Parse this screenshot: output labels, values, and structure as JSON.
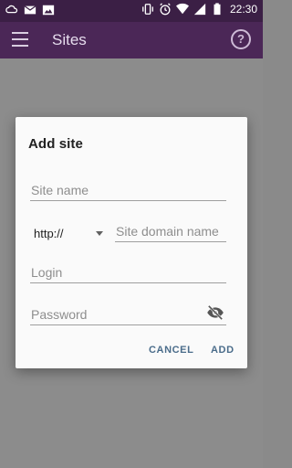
{
  "status_bar": {
    "time": "22:30",
    "left_icons": [
      "cloud-sync-icon",
      "mail-icon",
      "image-icon"
    ],
    "right_icons": [
      "vibrate-icon",
      "alarm-icon",
      "wifi-icon",
      "signal-icon",
      "battery-icon"
    ]
  },
  "app_bar": {
    "title": "Sites",
    "menu_icon": "menu-icon",
    "help_icon": "help-icon",
    "help_glyph": "?",
    "color": "#4b2757"
  },
  "dialog": {
    "title": "Add site",
    "site_name": {
      "placeholder": "Site name",
      "value": ""
    },
    "protocol": {
      "selected": "http://"
    },
    "domain": {
      "placeholder": "Site domain name",
      "value": ""
    },
    "login": {
      "placeholder": "Login",
      "value": ""
    },
    "password": {
      "placeholder": "Password",
      "value": "",
      "toggle_icon": "eye-off-icon"
    },
    "buttons": {
      "cancel": "CANCEL",
      "add": "ADD"
    },
    "accent_color": "#4a6c8a"
  }
}
